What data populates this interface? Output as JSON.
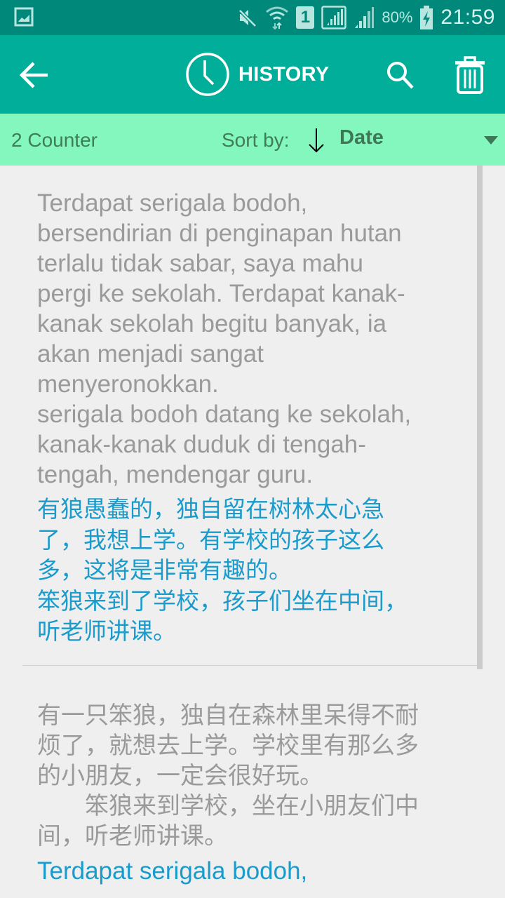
{
  "status_bar": {
    "icons": [
      "gallery-icon",
      "mute-icon",
      "wifi-icon",
      "sim1-icon",
      "signal-icon",
      "signal-icon-2",
      "battery-charging-icon"
    ],
    "sim_label": "1",
    "battery_percent": "80%",
    "time": "21:59"
  },
  "app_bar": {
    "title": "HISTORY",
    "back_icon": "arrow-left-icon",
    "title_icon": "clock-icon",
    "search_icon": "search-icon",
    "delete_icon": "trash-icon",
    "color": "#00ae99"
  },
  "sort_bar": {
    "count": "2 Counter",
    "sort_label": "Sort by:",
    "sort_direction_icon": "arrow-down-icon",
    "sort_value": "Date",
    "color": "#84f7bf"
  },
  "history": [
    {
      "source": "Terdapat serigala bodoh,\nbersendirian di penginapan hutan\nterlalu tidak sabar, saya mahu\npergi ke sekolah. Terdapat kanak-\nkanak sekolah begitu banyak, ia\nakan menjadi sangat\nmenyeronokkan.\nserigala bodoh datang ke sekolah,\nkanak-kanak duduk di tengah-\ntengah, mendengar guru.",
      "translation": "有狼愚蠢的，独自留在树林太心急\n了，我想上学。有学校的孩子这么\n多，这将是非常有趣的。\n笨狼来到了学校，孩子们坐在中间，\n听老师讲课。"
    },
    {
      "source": "有一只笨狼，独自在森林里呆得不耐\n烦了，就想去上学。学校里有那么多\n的小朋友，一定会很好玩。\n　　笨狼来到学校，坐在小朋友们中\n间，听老师讲课。",
      "translation": "Terdapat serigala bodoh,"
    }
  ],
  "colors": {
    "source_text": "#9a9a9a",
    "translation_text": "#1a9bcc",
    "status_bar": "#00897b"
  }
}
